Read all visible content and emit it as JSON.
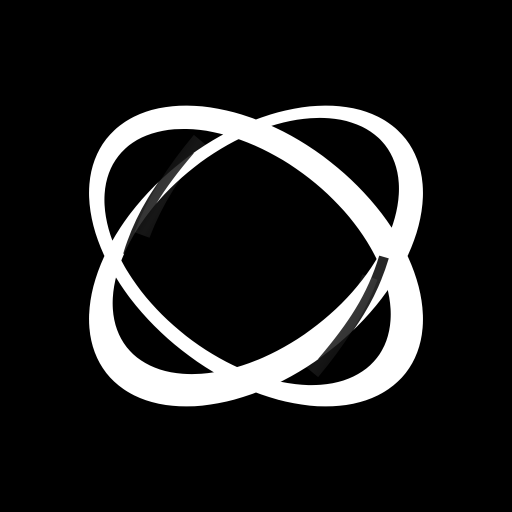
{
  "icon": {
    "name": "orbit-rings-icon",
    "background_color": "#000000",
    "foreground_color": "#ffffff"
  }
}
